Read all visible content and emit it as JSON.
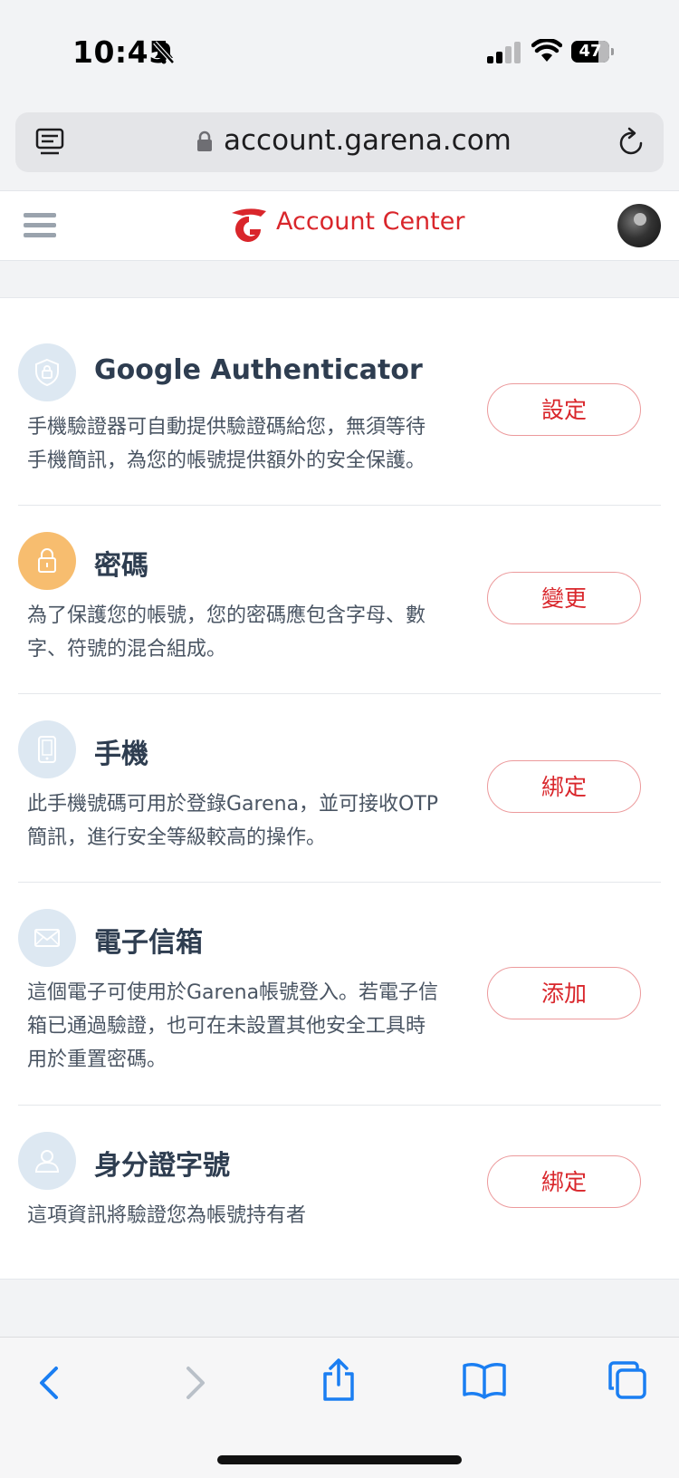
{
  "status_bar": {
    "time": "10:45",
    "battery": "47"
  },
  "browser": {
    "url": "account.garena.com"
  },
  "header": {
    "title": "Account Center"
  },
  "sections": [
    {
      "icon": "shield-icon",
      "title": "Google Authenticator",
      "desc_lines": [
        "手機驗證器可自動提供驗證碼給您，無須等待",
        "手機簡訊，為您的帳號提供額外的安全保護。"
      ],
      "button": "設定"
    },
    {
      "icon": "lock-icon",
      "title": "密碼",
      "desc_lines": [
        "為了保護您的帳號，您的密碼應包含字母、數",
        "字、符號的混合組成。"
      ],
      "button": "變更"
    },
    {
      "icon": "phone-icon",
      "title": "手機",
      "desc_lines": [
        "此手機號碼可用於登錄Garena，並可接收OTP",
        "簡訊，進行安全等級較高的操作。"
      ],
      "button": "綁定"
    },
    {
      "icon": "mail-icon",
      "title": "電子信箱",
      "desc_lines": [
        "這個電子可使用於Garena帳號登入。若電子信",
        "箱已通過驗證，也可在未設置其他安全工具時",
        "用於重置密碼。"
      ],
      "button": "添加"
    },
    {
      "icon": "id-card-icon",
      "title": "身分證字號",
      "desc_lines": [
        "這項資訊將驗證您為帳號持有者"
      ],
      "button": "綁定"
    }
  ],
  "colors": {
    "accent": "#d9262b",
    "icon_bg": "#dde8f2",
    "icon_bg_orange": "#f7bd6f",
    "title": "#2e3d50",
    "safari_blue": "#1a7ef2"
  }
}
